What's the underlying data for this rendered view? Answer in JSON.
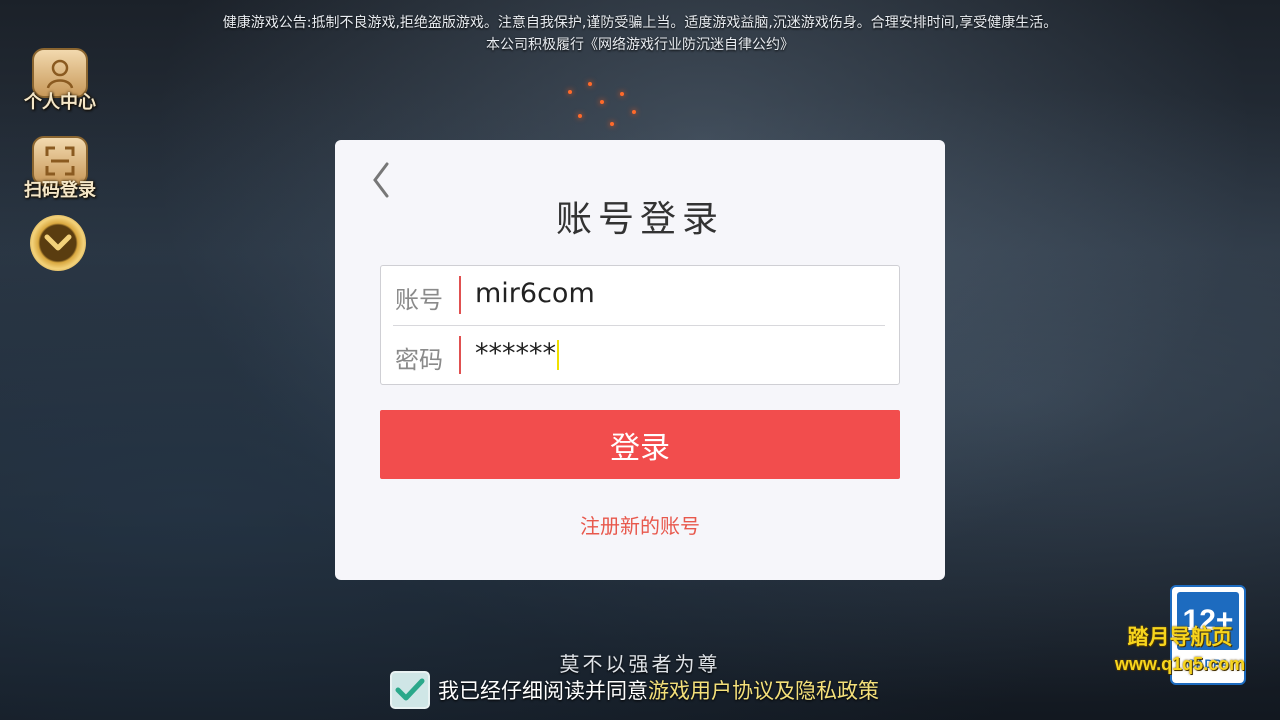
{
  "notice": {
    "line1": "健康游戏公告:抵制不良游戏,拒绝盗版游戏。注意自我保护,谨防受骗上当。适度游戏益脑,沉迷游戏伤身。合理安排时间,享受健康生活。",
    "line2": "本公司积极履行《网络游戏行业防沉迷自律公约》"
  },
  "sidebar": {
    "items": [
      {
        "label": "个人中心",
        "icon": "user-avatar-icon"
      },
      {
        "label": "扫码登录",
        "icon": "scan-qr-icon"
      },
      {
        "label": "",
        "icon": "chevron-down-icon"
      }
    ]
  },
  "login": {
    "title": "账号登录",
    "account_label": "账号",
    "account_value": "mir6com",
    "password_label": "密码",
    "password_value": "******",
    "submit_label": "登录",
    "register_label": "注册新的账号"
  },
  "footer": {
    "slogan": "莫不以强者为尊",
    "agree_text": "我已经仔细阅读并同意",
    "agree_link": "游戏用户协议及隐私政策",
    "agree_checked": true
  },
  "age_rating": {
    "age": "12+",
    "org": "CADPA"
  },
  "watermark": {
    "name": "踏月导航页",
    "url": "www.q1q5.com"
  },
  "colors": {
    "primary_button": "#f24d4d",
    "register_link": "#e8584c",
    "agreement_link": "#f4e07a",
    "input_separator": "#e05050"
  }
}
